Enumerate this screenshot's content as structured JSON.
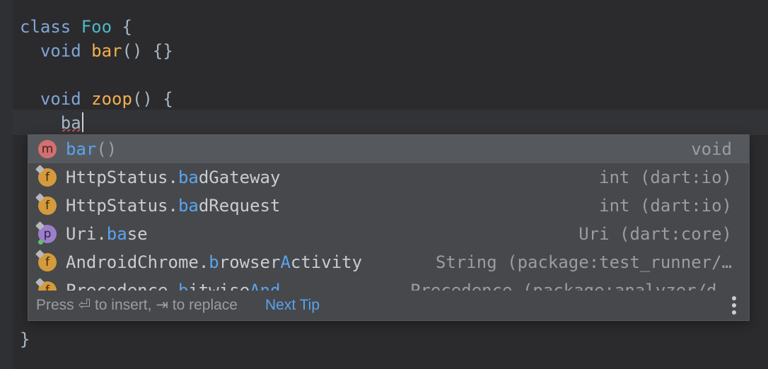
{
  "code": {
    "line1": {
      "kw": "class",
      "name": "Foo",
      "brace": "{"
    },
    "line2": {
      "kw": "void",
      "name": "bar",
      "rest": "() {}"
    },
    "line4": {
      "kw": "void",
      "name": "zoop",
      "rest": "() {"
    },
    "line5": {
      "typed": "ba"
    },
    "line_end": {
      "brace": "}"
    }
  },
  "completion": {
    "items": [
      {
        "kind": "m",
        "prefix": "",
        "match": "bar",
        "suffix": "",
        "args": "()",
        "type": "void",
        "selected": true
      },
      {
        "kind": "f",
        "prefix": "HttpStatus.",
        "match": "ba",
        "suffix": "dGateway",
        "type": "int (dart:io)"
      },
      {
        "kind": "f",
        "prefix": "HttpStatus.",
        "match": "ba",
        "suffix": "dRequest",
        "type": "int (dart:io)"
      },
      {
        "kind": "p",
        "prefix": "Uri.",
        "match": "ba",
        "suffix": "se",
        "type": "Uri (dart:core)"
      },
      {
        "kind": "f",
        "prefix": "AndroidChrome.",
        "match": "b",
        "suffix": "rowser",
        "match2": "A",
        "suffix2": "ctivity",
        "type": "String (package:test_runner/…"
      },
      {
        "kind": "f",
        "prefix": "Precedence.",
        "match": "b",
        "suffix": "itwise",
        "match2": "And",
        "suffix2": "",
        "type": "Precedence (package:analyzer/dart/as"
      }
    ],
    "footer": {
      "hint": "Press ⏎ to insert, ⇥ to replace",
      "next_tip": "Next Tip"
    }
  },
  "colors": {
    "background": "#2b2b2d",
    "popup": "#46484b",
    "selected": "#55595e",
    "match": "#5aa3f0",
    "keyword": "#7fa6d8",
    "function": "#f2b04e",
    "class": "#4fb8c6"
  }
}
